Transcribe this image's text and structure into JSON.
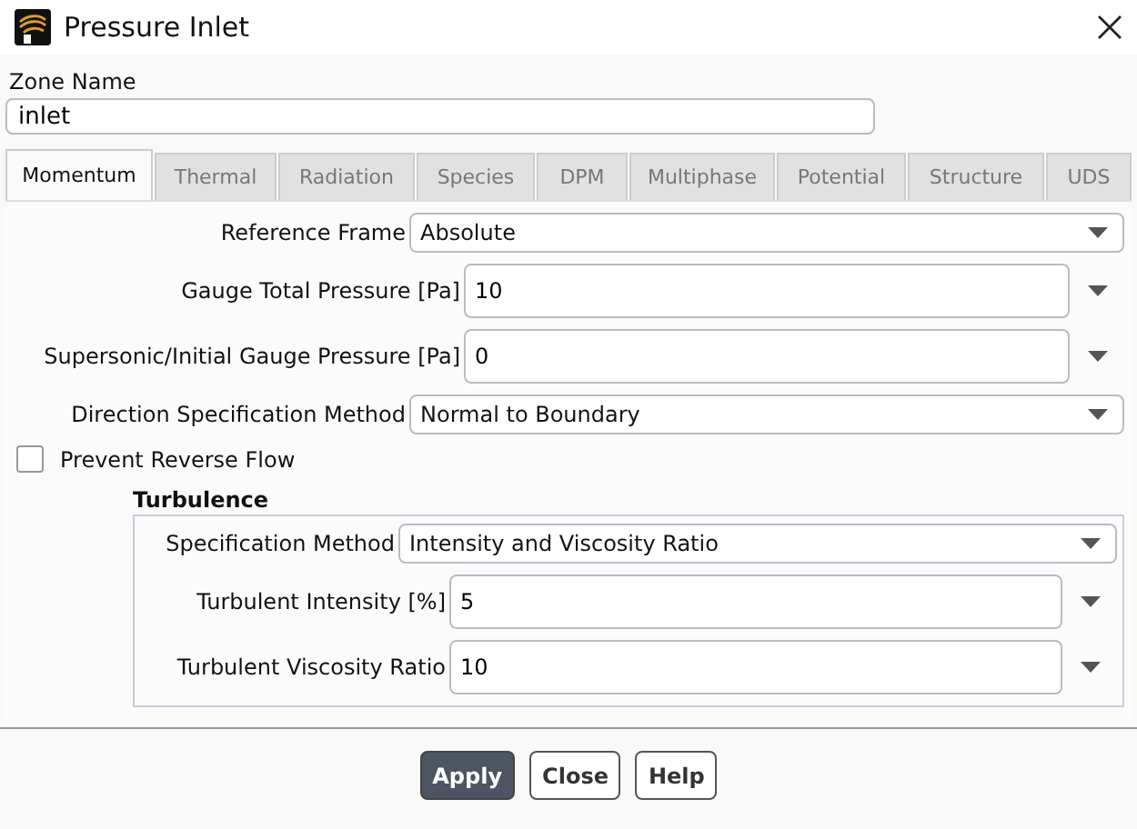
{
  "window": {
    "title": "Pressure Inlet"
  },
  "zone_name": {
    "label": "Zone Name",
    "value": "inlet"
  },
  "tabs": [
    {
      "label": "Momentum",
      "selected": true
    },
    {
      "label": "Thermal",
      "selected": false
    },
    {
      "label": "Radiation",
      "selected": false
    },
    {
      "label": "Species",
      "selected": false
    },
    {
      "label": "DPM",
      "selected": false
    },
    {
      "label": "Multiphase",
      "selected": false
    },
    {
      "label": "Potential",
      "selected": false
    },
    {
      "label": "Structure",
      "selected": false
    },
    {
      "label": "UDS",
      "selected": false
    }
  ],
  "fields": [
    {
      "kind": "dropdown",
      "label": "Reference Frame",
      "value": "Absolute"
    },
    {
      "kind": "number",
      "label": "Gauge Total Pressure [Pa]",
      "value": "10"
    },
    {
      "kind": "number",
      "label": "Supersonic/Initial Gauge Pressure [Pa]",
      "value": "0"
    },
    {
      "kind": "dropdown",
      "label": "Direction Specification Method",
      "value": "Normal to Boundary"
    }
  ],
  "prevent_reverse_flow": {
    "label": "Prevent Reverse Flow",
    "checked": false
  },
  "turbulence": {
    "title": "Turbulence",
    "fields": [
      {
        "kind": "dropdown",
        "label": "Specification Method",
        "value": "Intensity and Viscosity Ratio"
      },
      {
        "kind": "number",
        "label": "Turbulent Intensity [%]",
        "value": "5"
      },
      {
        "kind": "number",
        "label": "Turbulent Viscosity Ratio",
        "value": "10"
      }
    ]
  },
  "buttons": [
    {
      "label": "Apply",
      "kind": "primary"
    },
    {
      "label": "Close",
      "kind": "normal"
    },
    {
      "label": "Help",
      "kind": "normal"
    }
  ]
}
